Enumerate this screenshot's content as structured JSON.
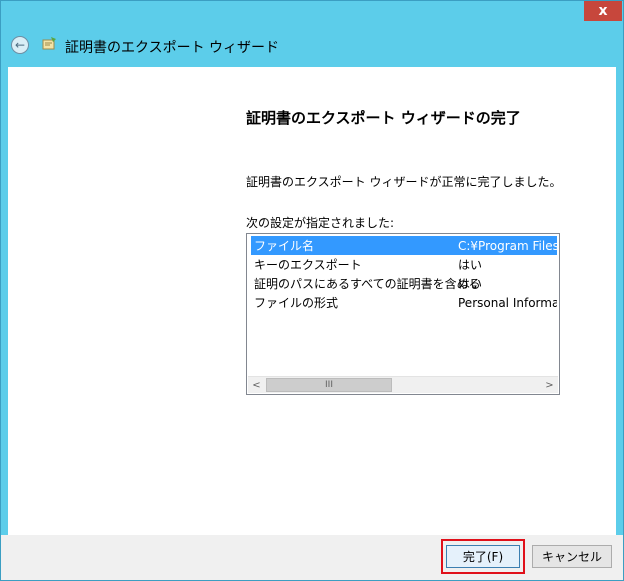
{
  "window": {
    "title": "証明書のエクスポート ウィザード",
    "close_glyph": "x"
  },
  "back_glyph": "←",
  "heading": "証明書のエクスポート ウィザードの完了",
  "message": "証明書のエクスポート ウィザードが正常に完了しました。",
  "settings_label": "次の設定が指定されました:",
  "settings": {
    "rows": [
      {
        "name": "ファイル名",
        "value": "C:¥Program Files"
      },
      {
        "name": "キーのエクスポート",
        "value": "はい"
      },
      {
        "name": "証明のパスにあるすべての証明書を含める",
        "value": "はい"
      },
      {
        "name": "ファイルの形式",
        "value": "Personal Informa"
      }
    ],
    "selected_index": 0
  },
  "scrollbar": {
    "left_glyph": "<",
    "right_glyph": ">",
    "thumb_glyph": "III"
  },
  "buttons": {
    "finish": "完了(F)",
    "cancel": "キャンセル"
  },
  "colors": {
    "frame": "#5ccdea",
    "close": "#c7473c",
    "selection": "#3399ff",
    "highlight_outline": "#e0101a"
  }
}
